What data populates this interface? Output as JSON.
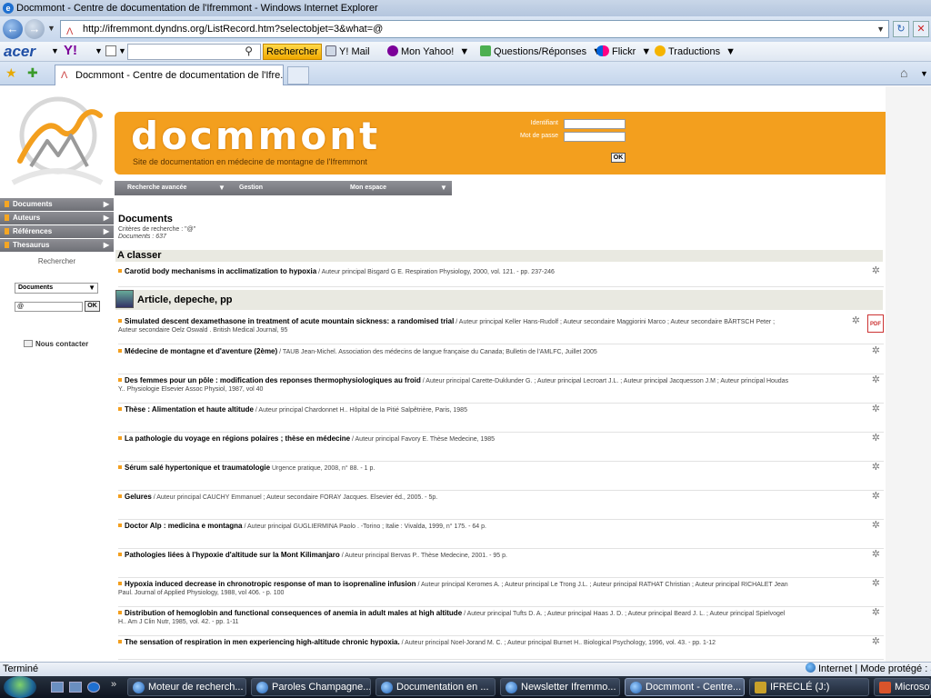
{
  "browser": {
    "window_title": "Docmmont - Centre de documentation de l'Ifremmont - Windows Internet Explorer",
    "url": "http://ifremmont.dyndns.org/ListRecord.htm?selectobjet=3&what=@",
    "tab_title": "Docmmont - Centre de documentation de l'Ifre...",
    "status_left": "Terminé",
    "status_right": "Internet | Mode protégé : a"
  },
  "toolbar": {
    "acer": "acer",
    "yahoo": "Y!",
    "search_button": "Rechercher",
    "items": [
      "Y! Mail",
      "Mon Yahoo!",
      "Questions/Réponses",
      "Flickr",
      "Traductions"
    ]
  },
  "site": {
    "brand": "docmmont",
    "subtitle": "Site de documentation en médecine de montagne de l'Ifremmont",
    "login_label": "Identifiant",
    "password_label": "Mot de passe",
    "ok": "OK",
    "top_menu": [
      "Recherche avancée",
      "Gestion",
      "Mon espace"
    ],
    "side_menu": [
      "Documents",
      "Auteurs",
      "Références",
      "Thesaurus"
    ],
    "search_label": "Rechercher",
    "search_select": "Documents",
    "search_value": "@",
    "contact": "Nous contacter"
  },
  "results": {
    "title": "Documents",
    "criteria": "Critères de recherche : \"@\"",
    "count": "Documents : 637",
    "section1": "A classer",
    "section2": "Article, depeche, pp",
    "records": [
      {
        "title": "Carotid body mechanisms in acclimatization to hypoxia",
        "meta": " / Auteur principal Bisgard G E. Respiration Physiology, 2000, vol. 121. - pp. 237-246"
      },
      {
        "title": "Simulated descent dexamethasone in treatment of acute mountain sickness: a randomised trial",
        "meta": " / Auteur principal Keller Hans-Rudolf ; Auteur secondaire Maggiorini Marco ; Auteur secondaire BÄRTSCH Peter ; Auteur secondaire Oelz Oswald . British Medical Journal, 95"
      },
      {
        "title": "Médecine de montagne et d'aventure (2ème)",
        "meta": " / TAUB Jean-Michel. Association des médecins de langue française du Canada; Bulletin de l'AMLFC, Juillet 2005"
      },
      {
        "title": "Des femmes pour un pôle : modification des reponses thermophysiologiques au froid",
        "meta": " / Auteur principal Carette-Duklunder G. ; Auteur principal Lecroart J.L. ; Auteur principal Jacquesson J.M ; Auteur principal Houdas Y.. Physiologie Elsevier Assoc Physiol, 1987, vol 40"
      },
      {
        "title": "Thèse : Alimentation et haute altitude",
        "meta": " / Auteur principal Chardonnet H.. Hôpital de la Pitié Salpêtrière, Paris, 1985"
      },
      {
        "title": "La pathologie du voyage en régions polaires ; thèse en médecine",
        "meta": " / Auteur principal Favory E. Thèse Medecine, 1985"
      },
      {
        "title": "Sérum salé hypertonique et traumatologie",
        "meta": " Urgence pratique, 2008, n° 88. - 1 p."
      },
      {
        "title": "Gelures",
        "meta": " / Auteur principal CAUCHY Emmanuel ; Auteur secondaire FORAY Jacques. Elsevier éd., 2005. - 5p."
      },
      {
        "title": "Doctor Alp : medicina e montagna",
        "meta": " / Auteur principal GUGLIERMINA Paolo . -Torino ; Italie : Vivalda, 1999, n° 175. - 64 p."
      },
      {
        "title": "Pathologies liées à l'hypoxie d'altitude sur la Mont Kilimanjaro",
        "meta": " / Auteur principal Bervas P.. Thèse Medecine, 2001. - 95 p."
      },
      {
        "title": "Hypoxia induced decrease in chronotropic response of man to isoprenaline infusion",
        "meta": " / Auteur principal Keromes A. ; Auteur principal Le Trong J.L. ; Auteur principal RATHAT Christian ; Auteur principal RICHALET Jean Paul. Journal of Applied Physiology, 1988, vol 406. - p. 100"
      },
      {
        "title": "Distribution of hemoglobin and functional consequences of anemia in adult males at high altitude",
        "meta": " / Auteur principal Tufts D. A. ; Auteur principal Haas J. D. ; Auteur principal Beard J. L. ; Auteur principal Spielvogel H.. Am J Clin Nutr, 1985, vol. 42. - pp. 1-11"
      },
      {
        "title": "The sensation of respiration in men experiencing high-altitude chronic hypoxia.",
        "meta": " / Auteur principal Noel-Jorand M. C. ; Auteur principal Burnet H.. Biological Psychology, 1996, vol. 43. - pp. 1-12"
      }
    ],
    "pdf_label": "PDF"
  },
  "taskbar": {
    "buttons": [
      "Moteur de recherch...",
      "Paroles Champagne...",
      "Documentation en ...",
      "Newsletter Ifremmo...",
      "Docmmont - Centre...",
      "IFRECLÉ (J:)",
      "Microsof"
    ]
  },
  "icons": {
    "ie": "ie-icon",
    "pin": "pin-icon",
    "pdf": "pdf-icon"
  }
}
